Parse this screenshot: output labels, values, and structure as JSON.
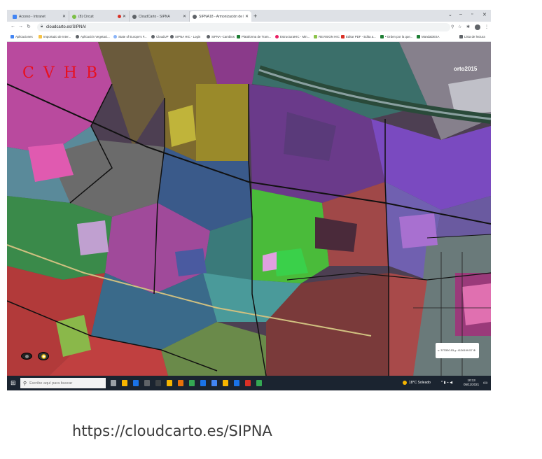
{
  "browser": {
    "tabs": [
      {
        "label": "Acceso - Intranet",
        "color": "#4285f4"
      },
      {
        "label": "(8) Circuit",
        "color": "#7cbf45"
      },
      {
        "label": "CloudCarto - SIPNA",
        "color": "#5f6368"
      },
      {
        "label": "SIPNA18 - Armonización de bib",
        "color": "#5f6368"
      }
    ],
    "new_tab": "+",
    "window_controls": {
      "menu": "⌄",
      "minimize": "–",
      "maximize": "▫",
      "close": "✕"
    },
    "url": "cloudcarto.es/SIPNA/",
    "bookmarks": [
      {
        "label": "Aplicaciones",
        "color": "#4285f4"
      },
      {
        "label": "Importado de Inter...",
        "color": "#f6c244"
      },
      {
        "label": "Aplicación Vegetaci...",
        "color": "#5f6368"
      },
      {
        "label": "State of Europe's F...",
        "color": "#8ab4f8"
      },
      {
        "label": "CloudUP",
        "color": "#5f6368"
      },
      {
        "label": "SIPNA HIC - Login",
        "color": "#5f6368"
      },
      {
        "label": "SIPNA -Cambios",
        "color": "#5f6368"
      },
      {
        "label": "Plataforma de Tram...",
        "color": "#1e7e34"
      },
      {
        "label": "EstructuraHIC - Min...",
        "color": "#e91e63"
      },
      {
        "label": "REVISION HIC",
        "color": "#8bc34a"
      },
      {
        "label": "Editar PDF - Edita a...",
        "color": "#d93025"
      },
      {
        "label": "• Orden por la que...",
        "color": "#1e7e34"
      },
      {
        "label": "MandaDESA",
        "color": "#1e7e34"
      },
      {
        "label": "Lista de lectura",
        "color": "#5f6368"
      }
    ]
  },
  "map": {
    "overlay_label": "C V H B",
    "ortho_label": "orto2015",
    "coordinates": "x: 373330.53 y: 4126199.57 ⊕"
  },
  "taskbar": {
    "search_placeholder": "Escribe aquí para buscar",
    "weather": "18°C  Soleado",
    "tray": "^ ▮ ⌁ ◀",
    "time": "10:13",
    "date": "05/11/2021",
    "apps": [
      "#9aa0a6",
      "#f6b500",
      "#1a73e8",
      "#5f6368",
      "#3c4043",
      "#f6b500",
      "#e8710a",
      "#34a853",
      "#1a73e8",
      "#4285f4",
      "#f6b500",
      "#1a73e8",
      "#d93025",
      "#34a853"
    ]
  },
  "caption": "https://cloudcarto.es/SIPNA"
}
